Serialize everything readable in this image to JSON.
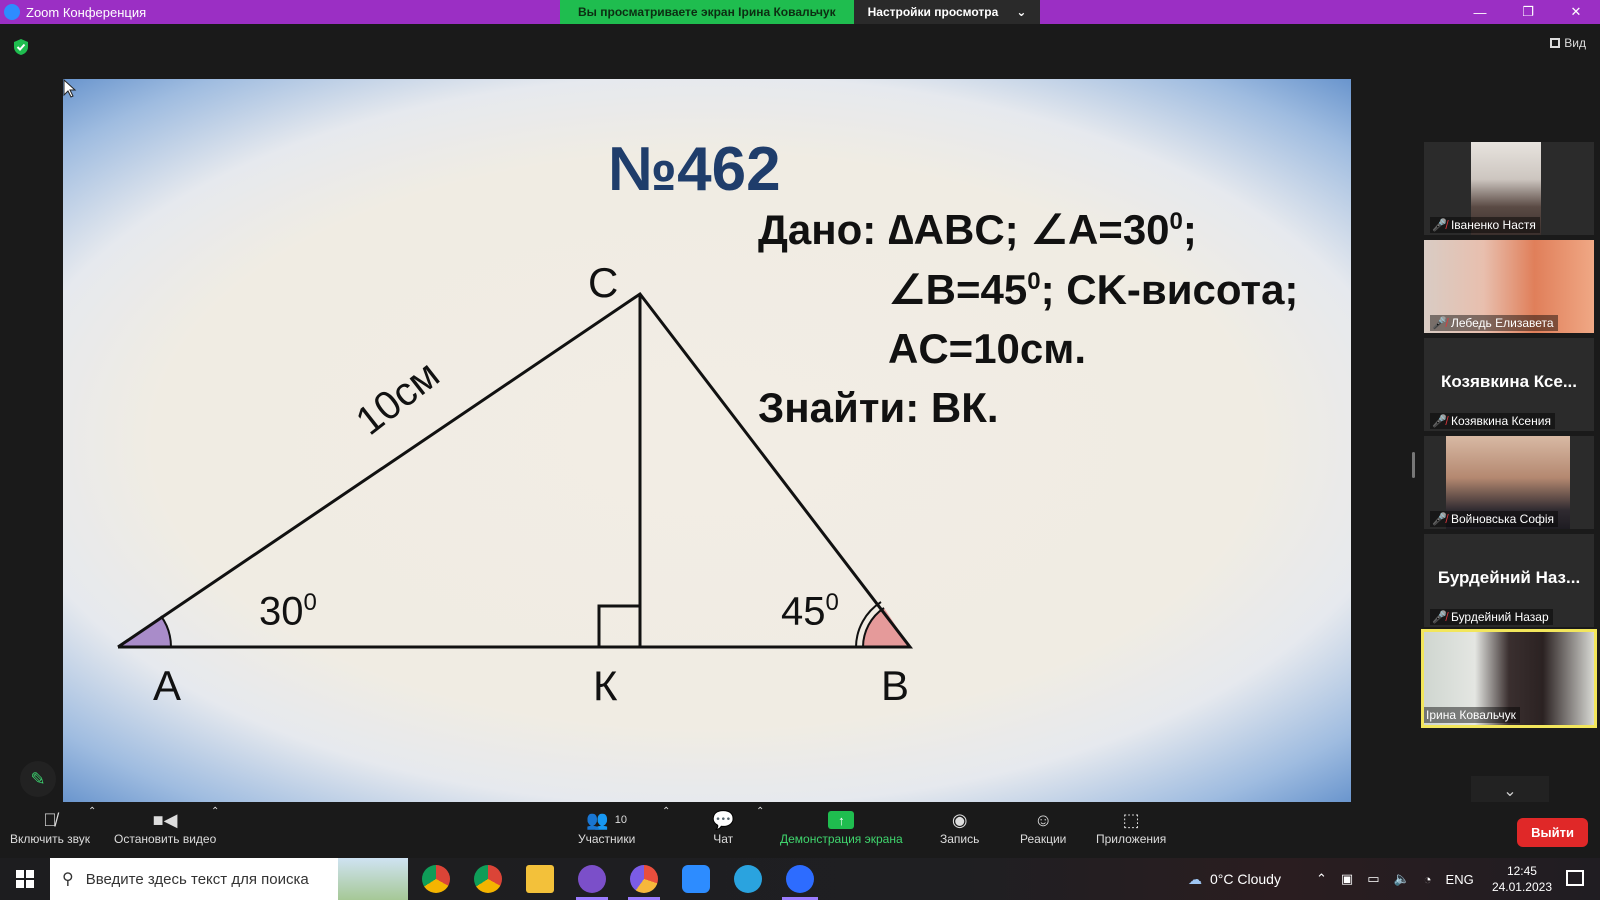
{
  "window": {
    "title": "Zoom Конференция",
    "viewing_banner": "Вы просматриваете экран Ірина Ковальчук",
    "view_settings": "Настройки просмотра",
    "view_button": "Вид"
  },
  "slide": {
    "title": "№462",
    "given_line1_prefix": "Дано: ∆ABC; ∠A=30",
    "given_line1_sup": "0",
    "given_line1_suffix": ";",
    "given_line2_prefix": "∠B=45",
    "given_line2_sup": "0",
    "given_line2_suffix": "; CK-висота;",
    "given_line3": "AC=10см.",
    "find": "Знайти: ВК.",
    "vertex_a": "A",
    "vertex_b": "B",
    "vertex_c": "C",
    "vertex_k": "К",
    "side_ac": "10см",
    "angle_a_value": "30",
    "angle_a_sup": "0",
    "angle_b_value": "45",
    "angle_b_sup": "0"
  },
  "participants": [
    {
      "name": "Іваненко Настя",
      "video": true,
      "muted": true
    },
    {
      "name": "Лебедь Елизавета",
      "video": true,
      "muted": true
    },
    {
      "name": "Козявкина Ксения",
      "display": "Козявкина Ксе...",
      "video": false,
      "muted": true
    },
    {
      "name": "Войновська Софія",
      "video": true,
      "muted": true
    },
    {
      "name": "Бурдейний Назар",
      "display": "Бурдейний Наз...",
      "video": false,
      "muted": true
    },
    {
      "name": "Ірина Ковальчук",
      "video": true,
      "muted": false,
      "active": true
    }
  ],
  "toolbar": {
    "unmute": "Включить звук",
    "stop_video": "Остановить видео",
    "participants": "Участники",
    "participants_count": "10",
    "chat": "Чат",
    "share_screen": "Демонстрация экрана",
    "record": "Запись",
    "reactions": "Реакции",
    "apps": "Приложения",
    "leave": "Выйти"
  },
  "taskbar": {
    "search_placeholder": "Введите здесь текст для поиска",
    "weather": "0°C  Cloudy",
    "lang": "ENG",
    "time": "12:45",
    "date": "24.01.2023"
  }
}
